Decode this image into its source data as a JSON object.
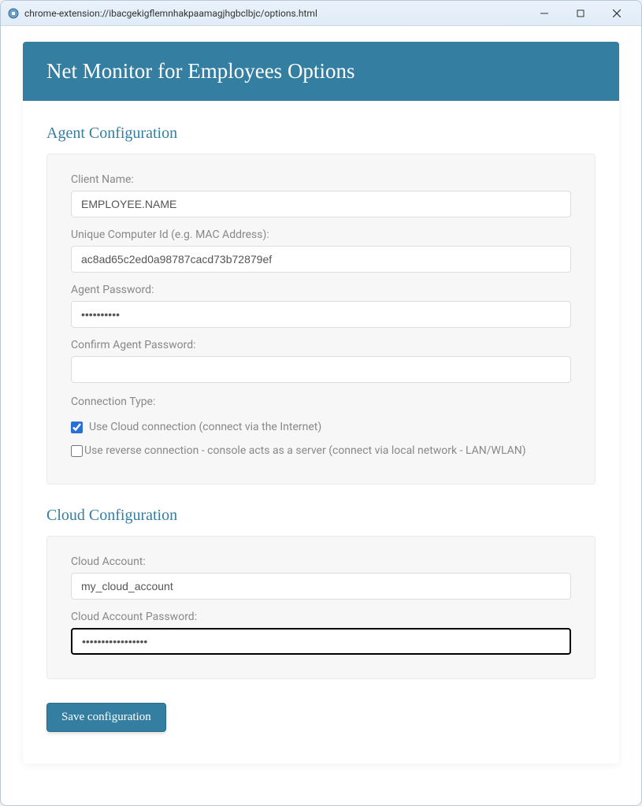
{
  "window": {
    "title": "chrome-extension://ibacgekigflemnhakpaamagjhgbclbjc/options.html"
  },
  "header": {
    "title": "Net Monitor for Employees Options"
  },
  "agent": {
    "section_title": "Agent Configuration",
    "client_name_label": "Client Name:",
    "client_name_value": "EMPLOYEE.NAME",
    "computer_id_label": "Unique Computer Id (e.g. MAC Address):",
    "computer_id_value": "ac8ad65c2ed0a98787cacd73b72879ef",
    "password_label": "Agent Password:",
    "password_value": "••••••••••",
    "confirm_password_label": "Confirm Agent Password:",
    "confirm_password_value": "",
    "connection_type_label": "Connection Type:",
    "cloud_checkbox_label": "Use Cloud connection (connect via the Internet)",
    "reverse_checkbox_label": "Use reverse connection - console acts as a server (connect via local network - LAN/WLAN)"
  },
  "cloud": {
    "section_title": "Cloud Configuration",
    "account_label": "Cloud Account:",
    "account_value": "my_cloud_account",
    "password_label": "Cloud Account Password:",
    "password_value": "•••••••••••••••••"
  },
  "save_button_label": "Save configuration"
}
